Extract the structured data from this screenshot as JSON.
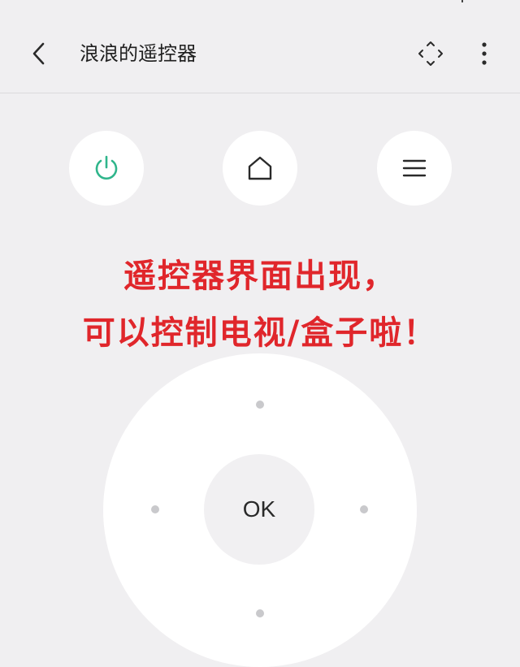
{
  "header": {
    "title": "浪浪的遥控器"
  },
  "controls": {
    "ok_label": "OK"
  },
  "annotation": {
    "line1": "遥控器界面出现，",
    "line2": "可以控制电视/盒子啦！"
  },
  "colors": {
    "background": "#f0eff1",
    "power_accent": "#2fb58b",
    "annotation_text": "#e0262b"
  },
  "icons": {
    "back": "chevron-left-icon",
    "expand": "expand-arrows-icon",
    "more": "more-vertical-icon",
    "power": "power-icon",
    "home": "home-icon",
    "menu": "menu-icon"
  }
}
